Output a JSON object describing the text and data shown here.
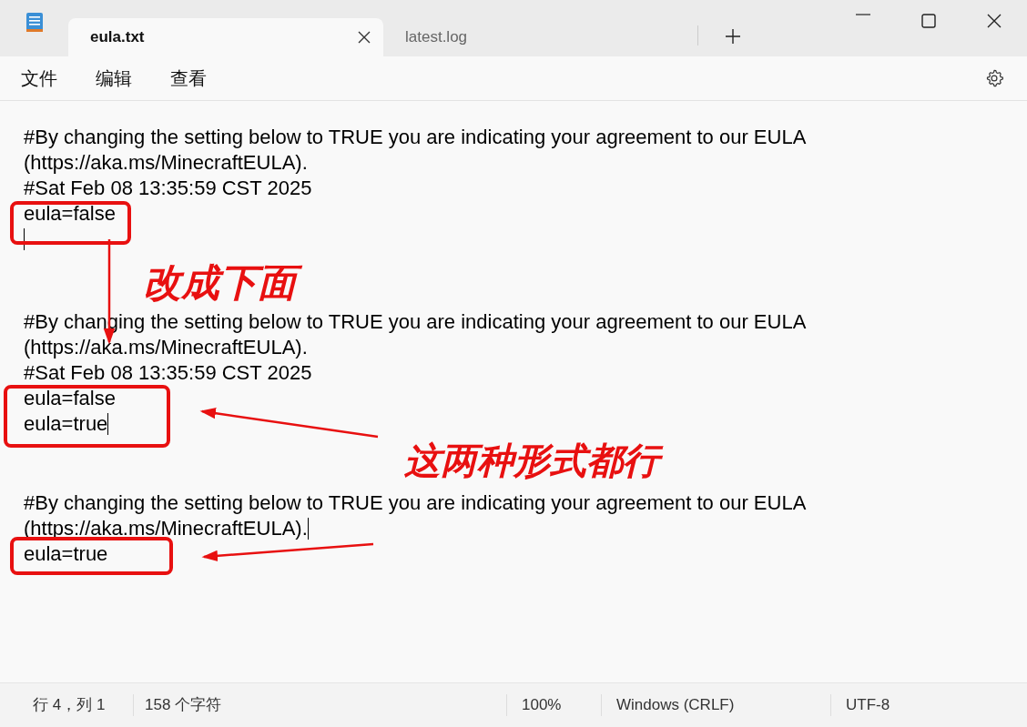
{
  "tabs": [
    {
      "label": "eula.txt",
      "selected": true
    },
    {
      "label": "latest.log",
      "selected": false
    }
  ],
  "menu": [
    "文件",
    "编辑",
    "查看"
  ],
  "editor": {
    "blocks": [
      {
        "lines": [
          {
            "text": "#By changing the setting below to TRUE you are indicating your agreement to our EULA",
            "caret": false
          },
          {
            "text": "(https://aka.ms/MinecraftEULA).",
            "caret": false
          },
          {
            "text": "#Sat Feb 08 13:35:59 CST 2025",
            "caret": false
          },
          {
            "text": "eula=false",
            "caret": false
          },
          {
            "caret": true
          }
        ]
      },
      {
        "lines": [
          {
            "text": "#By changing the setting below to TRUE you are indicating your agreement to our EULA",
            "caret": false
          },
          {
            "text": "(https://aka.ms/MinecraftEULA).",
            "caret": false
          },
          {
            "text": "#Sat Feb 08 13:35:59 CST 2025",
            "caret": false
          },
          {
            "text": "eula=false",
            "caret": false
          },
          {
            "text": "eula=true",
            "caret": true
          }
        ]
      },
      {
        "lines": [
          {
            "text": "#By changing the setting below to TRUE you are indicating your agreement to our EULA",
            "caret": false
          },
          {
            "text": "(https://aka.ms/MinecraftEULA).",
            "caret": true
          },
          {
            "text": "eula=true",
            "caret": false
          }
        ]
      }
    ]
  },
  "annotations": [
    "改成下面",
    "这两种形式都行"
  ],
  "status_bar": {
    "position": "行 4，列 1",
    "characters": "158 个字符",
    "zoom": "100%",
    "line_ending": "Windows (CRLF)",
    "encoding": "UTF-8"
  }
}
